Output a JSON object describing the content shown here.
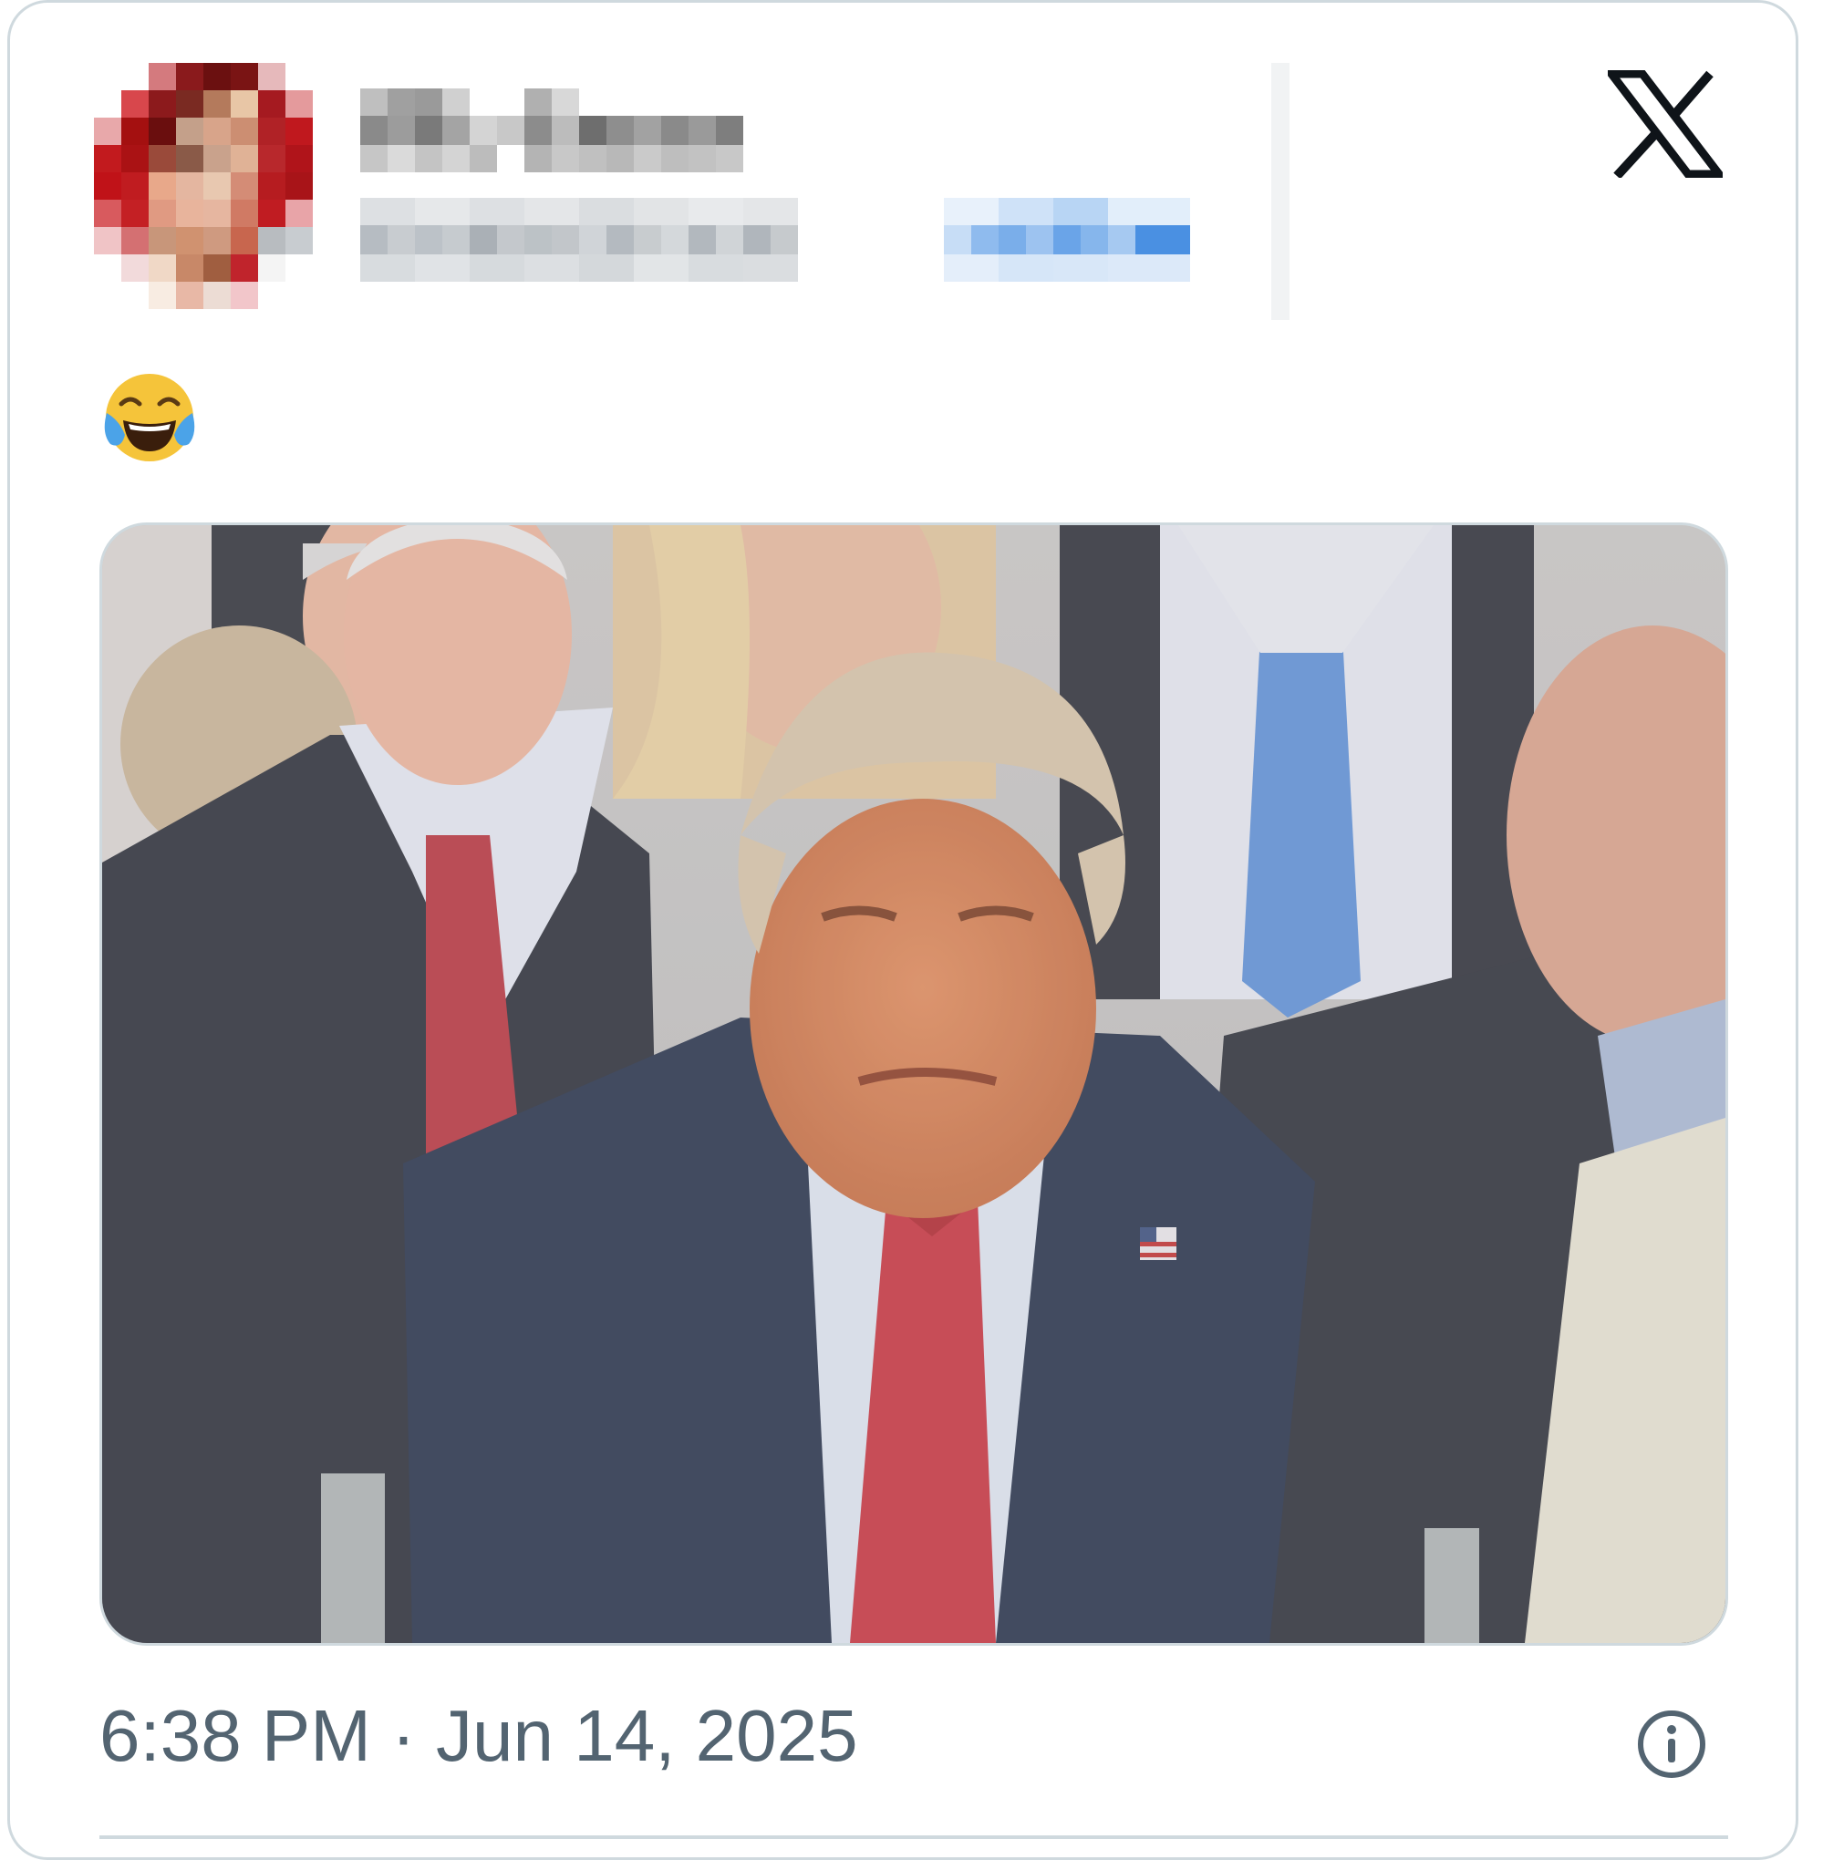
{
  "tweet": {
    "author_name": "",
    "author_handle": "",
    "follow_label": "",
    "body_emoji": "😂",
    "timestamp": "6:38 PM · Jun 14, 2025"
  },
  "icons": {
    "platform_logo": "x-logo-icon",
    "info": "info-icon"
  },
  "colors": {
    "border": "#cfd9de",
    "muted_text": "#536471",
    "link_blue": "#4a90e2"
  }
}
